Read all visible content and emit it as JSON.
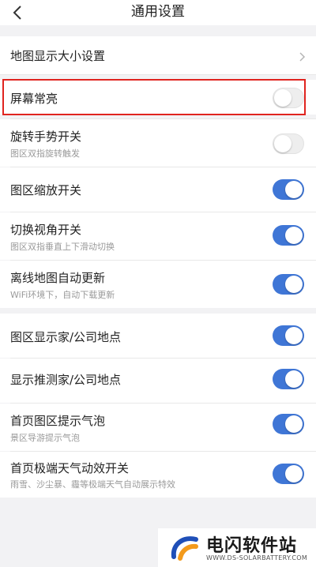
{
  "header": {
    "title": "通用设置"
  },
  "settings": {
    "map_size": {
      "label": "地图显示大小设置"
    },
    "screen_on": {
      "label": "屏幕常亮",
      "enabled": false
    },
    "rotate": {
      "label": "旋转手势开关",
      "sub": "图区双指旋转触发",
      "enabled": false
    },
    "zoom": {
      "label": "图区缩放开关",
      "enabled": true
    },
    "view_angle": {
      "label": "切换视角开关",
      "sub": "图区双指垂直上下滑动切换",
      "enabled": true
    },
    "offline": {
      "label": "离线地图自动更新",
      "sub": "WiFi环境下，自动下载更新",
      "enabled": true
    },
    "home_company": {
      "label": "图区显示家/公司地点",
      "enabled": true
    },
    "predict": {
      "label": "显示推测家/公司地点",
      "enabled": true
    },
    "bubble": {
      "label": "首页图区提示气泡",
      "sub": "景区导游提示气泡",
      "enabled": true
    },
    "weather": {
      "label": "首页极端天气动效开关",
      "sub": "雨雪、沙尘暴、霾等极端天气自动展示特效",
      "enabled": true
    }
  },
  "colors": {
    "toggle_on": "#3f76d6",
    "highlight": "#e0241f"
  },
  "watermark": {
    "name": "电闪软件站",
    "url": "WWW.DS-SOLARBATTERY.COM"
  }
}
